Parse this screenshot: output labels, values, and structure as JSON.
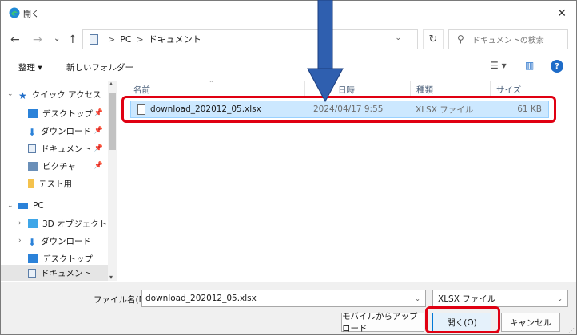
{
  "window": {
    "title": "開く"
  },
  "nav": {
    "back": "←",
    "forward": "→",
    "recent": "⌄",
    "up": "↑"
  },
  "address": {
    "segments": [
      "PC",
      "ドキュメント"
    ],
    "separator": ">"
  },
  "search": {
    "placeholder": "ドキュメントの検索"
  },
  "toolbar": {
    "organize": "整理 ▾",
    "new_folder": "新しいフォルダー"
  },
  "sidebar": {
    "items": [
      {
        "label": "クイック アクセス",
        "icon": "star-icon"
      },
      {
        "label": "デスクトップ",
        "icon": "desktop-folder-icon",
        "pinned": true
      },
      {
        "label": "ダウンロード",
        "icon": "download-folder-icon",
        "pinned": true
      },
      {
        "label": "ドキュメント",
        "icon": "documents-folder-icon",
        "pinned": true
      },
      {
        "label": "ピクチャ",
        "icon": "pictures-folder-icon",
        "pinned": true
      },
      {
        "label": "テスト用",
        "icon": "folder-icon"
      },
      {
        "label": "PC",
        "icon": "pc-icon"
      },
      {
        "label": "3D オブジェクト",
        "icon": "3d-objects-icon"
      },
      {
        "label": "ダウンロード",
        "icon": "download-folder-icon"
      },
      {
        "label": "デスクトップ",
        "icon": "desktop-folder-icon"
      },
      {
        "label": "ドキュメント",
        "icon": "documents-folder-icon",
        "selected": true
      }
    ]
  },
  "columns": {
    "name": "名前",
    "date": "日時",
    "type": "種類",
    "size": "サイズ"
  },
  "files": [
    {
      "name": "download_202012_05.xlsx",
      "date": "2024/04/17 9:55",
      "type": "XLSX ファイル",
      "size": "61 KB"
    }
  ],
  "bottom": {
    "filename_label": "ファイル名(N):",
    "filename_value": "download_202012_05.xlsx",
    "filetype": "XLSX ファイル",
    "mobile_upload": "モバイルからアップロード",
    "open": "開く(O)",
    "cancel": "キャンセル"
  },
  "colors": {
    "accent": "#0078d7",
    "selection": "#cce8ff",
    "highlight": "#e00012",
    "arrow": "#2f5faf"
  }
}
